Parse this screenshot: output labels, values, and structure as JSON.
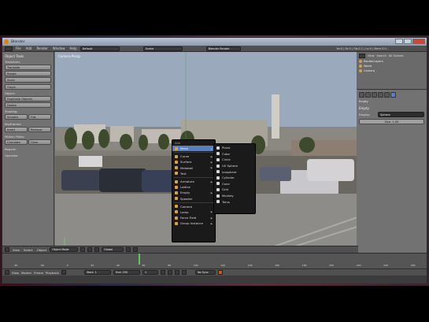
{
  "window": {
    "title": "Blender"
  },
  "infobar": {
    "menus": [
      "File",
      "Add",
      "Render",
      "Window",
      "Help"
    ],
    "layout": "Default",
    "scene": "Scene",
    "engine": "Blender Render",
    "stats": "Ve:0 | Fa:0 | Ob:0-1 | La:0 | Mem:3.0..."
  },
  "toolshelf": {
    "header": "Object Tools",
    "transform_label": "Transform:",
    "transform": [
      "Translate",
      "Rotate",
      "Scale"
    ],
    "origin": "Origin",
    "object_label": "Object:",
    "object_buttons": [
      "Duplicate Objects",
      "Delete"
    ],
    "shading_label": "Shading:",
    "shading": [
      "Smooth",
      "Flat"
    ],
    "keyframes_label": "Keyframes:",
    "keyframes": [
      "Insert",
      "Remove"
    ],
    "motion_label": "Motion Paths:",
    "motion": [
      "Calculate",
      "Clear"
    ],
    "repeat_label": "Repeat:",
    "operator": "Operator"
  },
  "viewport": {
    "view_label": "Camera Persp",
    "object_label": "(1) Empty"
  },
  "add_menu": {
    "title": "Add",
    "items": [
      {
        "label": "Mesh",
        "active": true,
        "sub": true
      },
      {
        "label": "Curve",
        "active": false,
        "sub": true
      },
      {
        "label": "Surface",
        "active": false,
        "sub": true
      },
      {
        "label": "Metaball",
        "active": false,
        "sub": true
      },
      {
        "label": "Text",
        "active": false,
        "sub": false
      },
      {
        "label": "Armature",
        "active": false,
        "sub": true
      },
      {
        "label": "Lattice",
        "active": false,
        "sub": false
      },
      {
        "label": "Empty",
        "active": false,
        "sub": true
      },
      {
        "label": "Speaker",
        "active": false,
        "sub": false
      },
      {
        "label": "Camera",
        "active": false,
        "sub": false
      },
      {
        "label": "Lamp",
        "active": false,
        "sub": true
      },
      {
        "label": "Force Field",
        "active": false,
        "sub": true
      },
      {
        "label": "Group Instance",
        "active": false,
        "sub": true
      }
    ]
  },
  "mesh_submenu": {
    "items": [
      "Plane",
      "Cube",
      "Circle",
      "UV Sphere",
      "Icosphere",
      "Cylinder",
      "Cone",
      "Grid",
      "Monkey",
      "Torus"
    ]
  },
  "outliner": {
    "tabs": [
      "View",
      "Search",
      "All Scenes"
    ],
    "items": [
      "RenderLayers",
      "World",
      "Camera"
    ]
  },
  "properties": {
    "path": "Empty",
    "section": "Empty",
    "display_label": "Display:",
    "display_value": "Sphere",
    "size": "Size: 1.00"
  },
  "viewport_header": {
    "menus": [
      "View",
      "Select",
      "Object"
    ],
    "mode": "Object Mode",
    "pivot": "Global"
  },
  "timeline": {
    "ticks": [
      "-40",
      "-20",
      "0",
      "20",
      "40",
      "60",
      "80",
      "100",
      "120",
      "140",
      "160",
      "180",
      "200",
      "220",
      "240",
      "260"
    ]
  },
  "timeline_header": {
    "menus": [
      "View",
      "Marker",
      "Frame",
      "Playback"
    ],
    "start": "Start: 1",
    "end": "End: 250",
    "current": "1",
    "sync": "No Sync"
  }
}
